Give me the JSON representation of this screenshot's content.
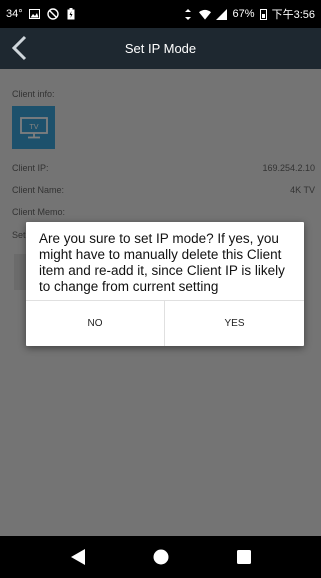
{
  "status_bar": {
    "temperature": "34°",
    "battery_percent": "67%",
    "time": "下午3:56"
  },
  "app_bar": {
    "title": "Set IP Mode"
  },
  "client": {
    "info_label": "Client info:",
    "tv_icon_text": "TV",
    "ip_label": "Client IP:",
    "ip_value": "169.254.2.10",
    "name_label": "Client Name:",
    "name_value": "4K TV",
    "memo_label": "Client Memo:",
    "setting_label_partial": "Set"
  },
  "dialog": {
    "message": "Are you sure to set IP mode? If yes, you might have to manually delete this Client item and re-add it, since Client IP is likely to change from current setting",
    "no_label": "NO",
    "yes_label": "YES"
  },
  "colors": {
    "app_bar": "#1e2830",
    "tv_tile": "#3aa3d8",
    "content_bg": "#e9e9e9"
  }
}
